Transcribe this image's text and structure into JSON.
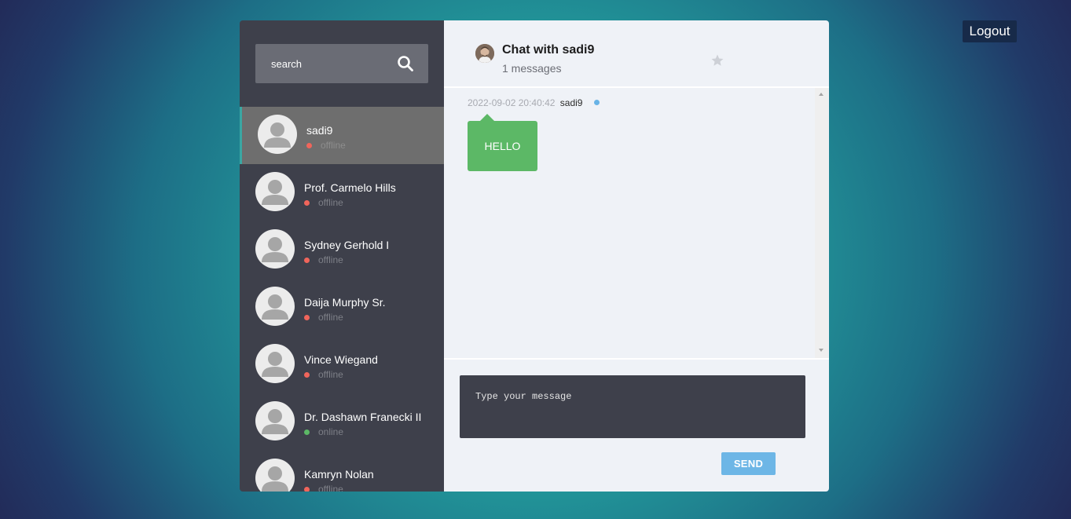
{
  "header": {
    "logout_label": "Logout"
  },
  "sidebar": {
    "search": {
      "placeholder": "search"
    },
    "contacts": [
      {
        "name": "sadi9",
        "status": "offline",
        "status_color": "#f0655b",
        "active": true
      },
      {
        "name": "Prof. Carmelo Hills",
        "status": "offline",
        "status_color": "#f0655b"
      },
      {
        "name": "Sydney Gerhold I",
        "status": "offline",
        "status_color": "#f0655b"
      },
      {
        "name": "Daija Murphy Sr.",
        "status": "offline",
        "status_color": "#f0655b"
      },
      {
        "name": "Vince Wiegand",
        "status": "offline",
        "status_color": "#f0655b"
      },
      {
        "name": "Dr. Dashawn Franecki II",
        "status": "online",
        "status_color": "#5cb866"
      },
      {
        "name": "Kamryn Nolan",
        "status": "offline",
        "status_color": "#f0655b"
      }
    ]
  },
  "chat": {
    "title": "Chat with sadi9",
    "message_count": "1 messages",
    "messages": [
      {
        "time": "2022-09-02 20:40:42",
        "author": "sadi9",
        "text": "HELLO"
      }
    ],
    "composer": {
      "placeholder": "Type your message"
    },
    "send_label": "SEND"
  },
  "colors": {
    "accent": "#3aa7a3",
    "bubble": "#5cb866",
    "send": "#6db6e6",
    "sidebar": "#3e404b"
  },
  "icons": {
    "search": "search-icon",
    "favorite": "star-icon",
    "user": "user-silhouette-icon"
  }
}
